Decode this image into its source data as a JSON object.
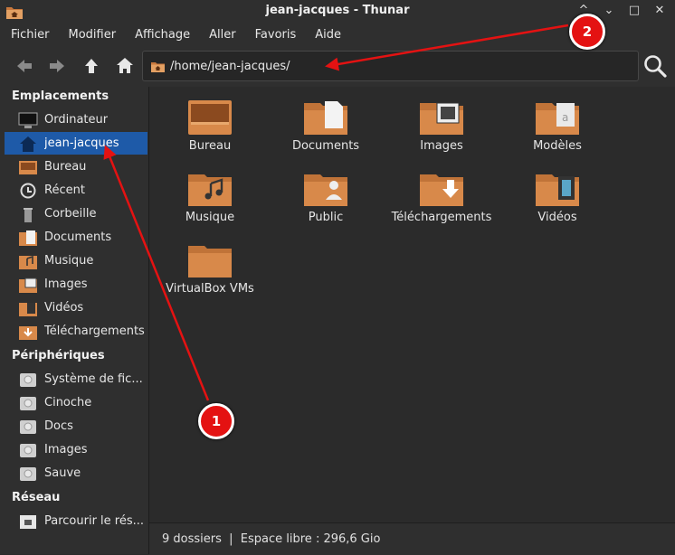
{
  "window": {
    "title": "jean-jacques - Thunar",
    "controls": [
      "^",
      "⌄",
      "□",
      "✕"
    ]
  },
  "menu": [
    "Fichier",
    "Modifier",
    "Affichage",
    "Aller",
    "Favoris",
    "Aide"
  ],
  "location": {
    "path": "/home/jean-jacques/"
  },
  "sidebar": {
    "sections": [
      {
        "title": "Emplacements",
        "items": [
          {
            "label": "Ordinateur",
            "icon": "computer-icon"
          },
          {
            "label": "jean-jacques",
            "icon": "home-folder-icon",
            "selected": true
          },
          {
            "label": "Bureau",
            "icon": "desktop-folder-icon"
          },
          {
            "label": "Récent",
            "icon": "recent-icon"
          },
          {
            "label": "Corbeille",
            "icon": "trash-icon"
          },
          {
            "label": "Documents",
            "icon": "documents-folder-icon"
          },
          {
            "label": "Musique",
            "icon": "music-folder-icon"
          },
          {
            "label": "Images",
            "icon": "images-folder-icon"
          },
          {
            "label": "Vidéos",
            "icon": "videos-folder-icon"
          },
          {
            "label": "Téléchargements",
            "icon": "downloads-folder-icon"
          }
        ]
      },
      {
        "title": "Périphériques",
        "items": [
          {
            "label": "Système de fic...",
            "icon": "drive-icon"
          },
          {
            "label": "Cinoche",
            "icon": "drive-icon"
          },
          {
            "label": "Docs",
            "icon": "drive-icon"
          },
          {
            "label": "Images",
            "icon": "drive-icon"
          },
          {
            "label": "Sauve",
            "icon": "drive-icon"
          }
        ]
      },
      {
        "title": "Réseau",
        "items": [
          {
            "label": "Parcourir le rés...",
            "icon": "network-icon"
          }
        ]
      }
    ]
  },
  "files": [
    {
      "label": "Bureau",
      "icon": "desktop-folder-icon"
    },
    {
      "label": "Documents",
      "icon": "documents-folder-icon"
    },
    {
      "label": "Images",
      "icon": "images-folder-icon"
    },
    {
      "label": "Modèles",
      "icon": "templates-folder-icon"
    },
    {
      "label": "Musique",
      "icon": "music-folder-icon"
    },
    {
      "label": "Public",
      "icon": "public-folder-icon"
    },
    {
      "label": "Téléchargements",
      "icon": "downloads-folder-icon"
    },
    {
      "label": "Vidéos",
      "icon": "videos-folder-icon"
    },
    {
      "label": "VirtualBox VMs",
      "icon": "folder-icon"
    }
  ],
  "status": {
    "text": "9 dossiers  |  Espace libre : 296,6 Gio"
  },
  "annotations": [
    {
      "label": "1"
    },
    {
      "label": "2"
    }
  ],
  "colors": {
    "selection": "#1e5aa8",
    "folder": "#d8894a",
    "annotation": "#e41212"
  }
}
